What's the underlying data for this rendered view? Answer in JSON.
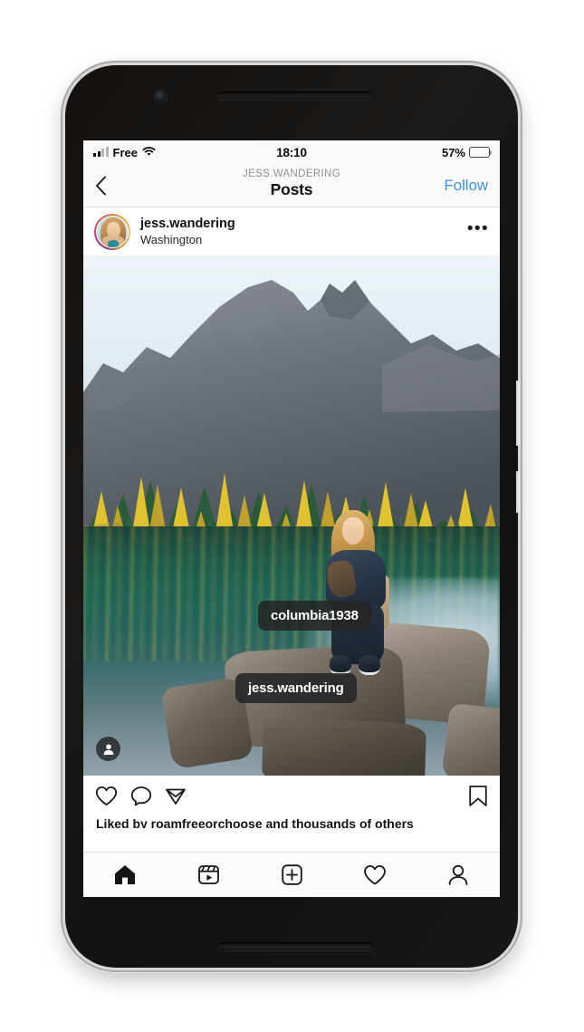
{
  "device": {
    "frame": "iphone",
    "front_camera": "front-camera",
    "earpiece": "earpiece-speaker"
  },
  "status_bar": {
    "carrier": "Free",
    "signal_icon": "signal-bars-icon",
    "wifi_icon": "wifi-icon",
    "time": "18:10",
    "battery_percent": "57%",
    "battery_level": 57,
    "battery_color": "#fdc72b"
  },
  "nav_bar": {
    "back_icon": "chevron-left-icon",
    "subtitle": "JESS.WANDERING",
    "title": "Posts",
    "follow_label": "Follow",
    "follow_color": "#3d93e0"
  },
  "post": {
    "username": "jess.wandering",
    "location": "Washington",
    "avatar_icon": "avatar",
    "more_label": "•••",
    "photo_alt": "Woman sitting on rocks beside a turquoise alpine lake with golden larch forest and grey mountain peak",
    "tags": [
      {
        "label": "columbia1938"
      },
      {
        "label": "jess.wandering"
      }
    ],
    "tagged_people_icon": "person-tag-icon"
  },
  "actions": {
    "like_icon": "heart-icon",
    "comment_icon": "comment-bubble-icon",
    "share_icon": "paper-plane-icon",
    "save_icon": "bookmark-icon"
  },
  "likes": {
    "text": "Liked by roamfreeorchoose and thousands of others"
  },
  "tab_bar": {
    "items": [
      {
        "name": "home",
        "icon": "home-icon",
        "active": true
      },
      {
        "name": "reels",
        "icon": "reels-icon",
        "active": false
      },
      {
        "name": "create",
        "icon": "plus-square-icon",
        "active": false
      },
      {
        "name": "activity",
        "icon": "heart-icon",
        "active": false
      },
      {
        "name": "profile",
        "icon": "person-icon",
        "active": false
      }
    ]
  }
}
